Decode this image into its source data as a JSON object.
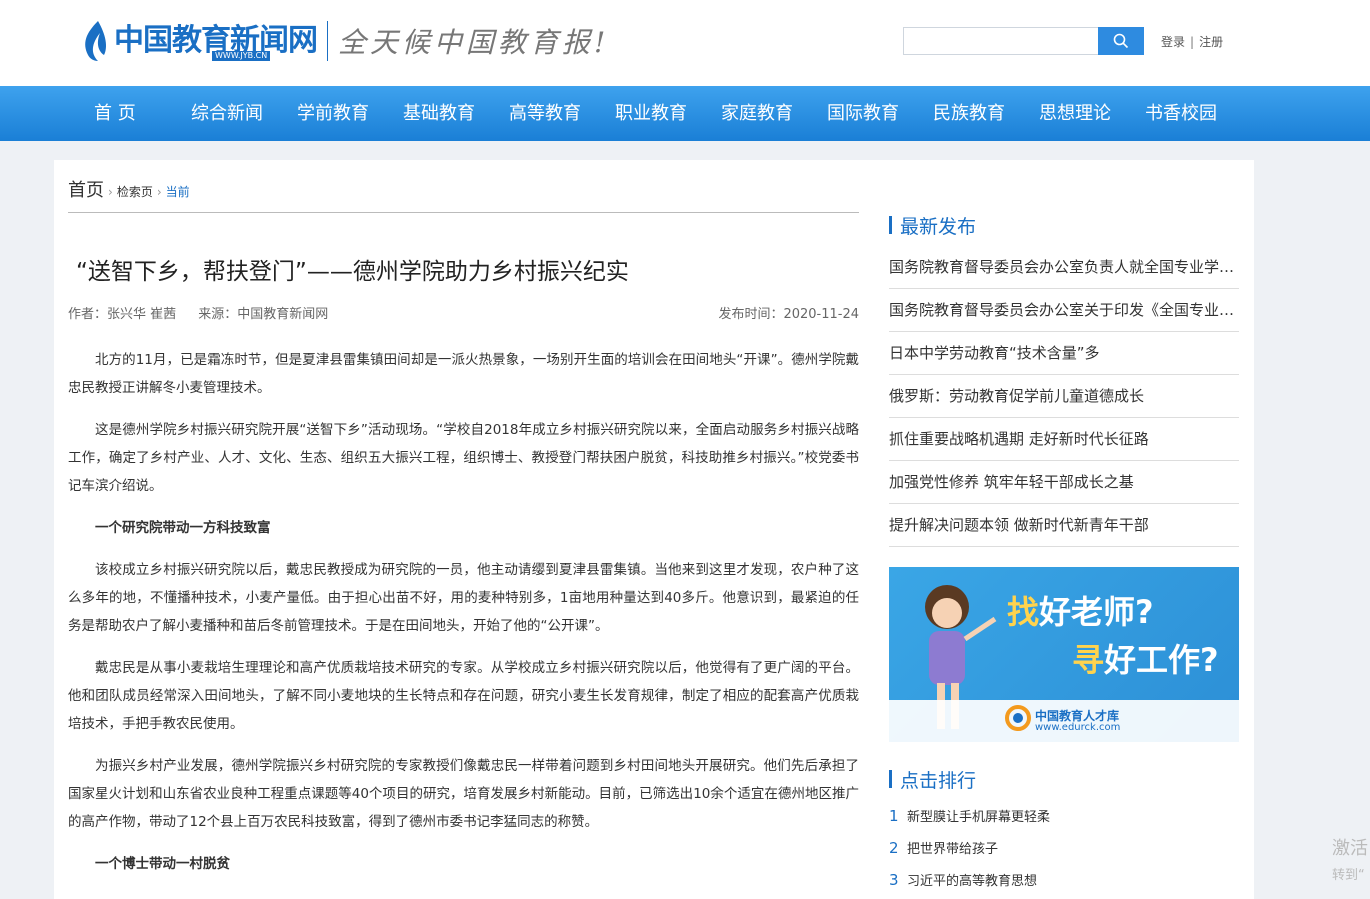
{
  "header": {
    "logo_name": "中国教育新闻网",
    "logo_url": "WWW.JYB.CN",
    "slogan": "全天候中国教育报!",
    "search_placeholder": "",
    "search_icon": "search-icon",
    "login": "登录",
    "separator": "|",
    "register": "注册"
  },
  "nav": [
    "首 页",
    "综合新闻",
    "学前教育",
    "基础教育",
    "高等教育",
    "职业教育",
    "家庭教育",
    "国际教育",
    "民族教育",
    "思想理论",
    "书香校园"
  ],
  "breadcrumb": {
    "home": "首页",
    "search": "检索页",
    "current": "当前",
    "arrow": "›"
  },
  "article": {
    "title": "“送智下乡，帮扶登门”——德州学院助力乡村振兴纪实",
    "author_label": "作者：张兴华 崔茜",
    "source_label": "来源：中国教育新闻网",
    "date_label": "发布时间：2020-11-24",
    "paragraphs": [
      "北方的11月，已是霜冻时节，但是夏津县雷集镇田间却是一派火热景象，一场别开生面的培训会在田间地头“开课”。德州学院戴忠民教授正讲解冬小麦管理技术。",
      "这是德州学院乡村振兴研究院开展“送智下乡”活动现场。“学校自2018年成立乡村振兴研究院以来，全面启动服务乡村振兴战略工作，确定了乡村产业、人才、文化、生态、组织五大振兴工程，组织博士、教授登门帮扶困户脱贫，科技助推乡村振兴。”校党委书记车滨介绍说。",
      "一个研究院带动一方科技致富",
      "该校成立乡村振兴研究院以后，戴忠民教授成为研究院的一员，他主动请缨到夏津县雷集镇。当他来到这里才发现，农户种了这么多年的地，不懂播种技术，小麦产量低。由于担心出苗不好，用的麦种特别多，1亩地用种量达到40多斤。他意识到，最紧迫的任务是帮助农户了解小麦播种和苗后冬前管理技术。于是在田间地头，开始了他的“公开课”。",
      "戴忠民是从事小麦栽培生理理论和高产优质栽培技术研究的专家。从学校成立乡村振兴研究院以后，他觉得有了更广阔的平台。他和团队成员经常深入田间地头，了解不同小麦地块的生长特点和存在问题，研究小麦生长发育规律，制定了相应的配套高产优质栽培技术，手把手教农民使用。",
      "为振兴乡村产业发展，德州学院振兴乡村研究院的专家教授们像戴忠民一样带着问题到乡村田间地头开展研究。他们先后承担了国家星火计划和山东省农业良种工程重点课题等40个项目的研究，培育发展乡村新能动。目前，已筛选出10余个适宜在德州地区推广的高产作物，带动了12个县上百万农民科技致富，得到了德州市委书记李猛同志的称赞。",
      "一个博士带动一村脱贫"
    ]
  },
  "sidebar": {
    "latest_title": "最新发布",
    "latest": [
      "国务院教育督导委员会办公室负责人就全国专业学位水平评估答记者问",
      "国务院教育督导委员会办公室关于印发《全国专业学位水平评估实施方案》的通知",
      "日本中学劳动教育“技术含量”多",
      "俄罗斯：劳动教育促学前儿童道德成长",
      "抓住重要战略机遇期 走好新时代长征路",
      "加强党性修养 筑牢年轻干部成长之基",
      "提升解决问题本领 做新时代新青年干部"
    ],
    "banner": {
      "line1_hl": "找",
      "line1": "好老师?",
      "line2_hl": "寻",
      "line2": "好工作?",
      "org": "中国教育人才库",
      "url": "www.edurck.com"
    },
    "rank_title": "点击排行",
    "rank": [
      {
        "num": "1",
        "text": "新型膜让手机屏幕更轻柔"
      },
      {
        "num": "2",
        "text": "把世界带给孩子"
      },
      {
        "num": "3",
        "text": "习近平的高等教育思想"
      }
    ]
  },
  "watermark": {
    "line1": "激活",
    "line2": "转到“"
  },
  "colors": {
    "accent": "#1a6fc4",
    "nav_top": "#3ea2ee",
    "nav_bottom": "#1a7fd6"
  }
}
